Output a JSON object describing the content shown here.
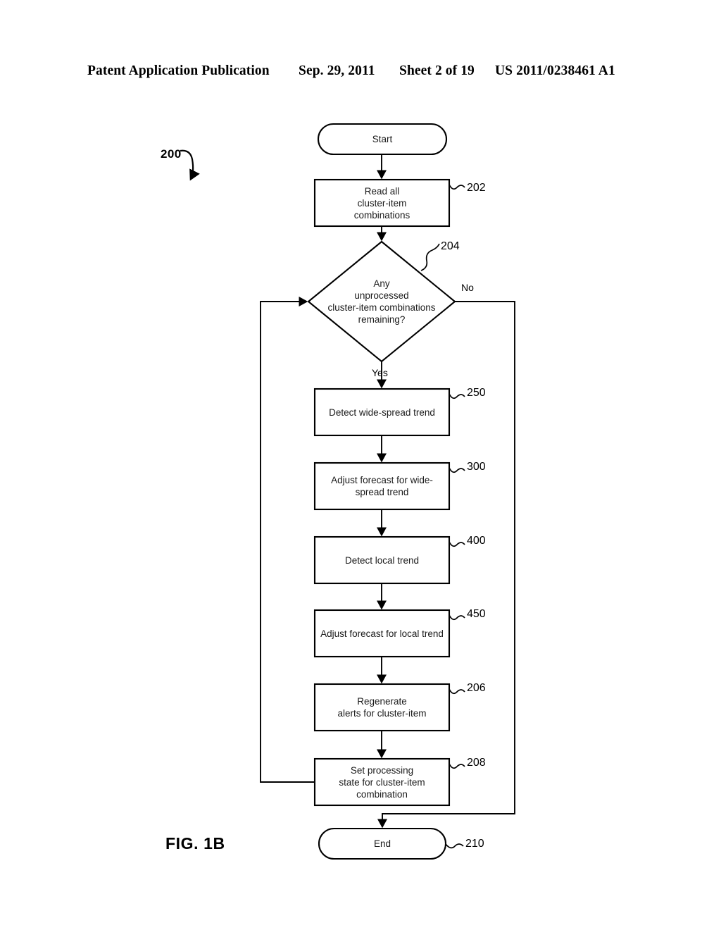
{
  "header": {
    "publication": "Patent Application Publication",
    "date": "Sep. 29, 2011",
    "sheet": "Sheet 2 of 19",
    "number": "US 2011/0238461 A1"
  },
  "figure": {
    "caption": "FIG. 1B",
    "diagram_ref": "200",
    "type": "flowchart"
  },
  "nodes": [
    {
      "id": "start",
      "label": "Start",
      "shape": "terminator",
      "ref": ""
    },
    {
      "id": "n202",
      "label": "Read all\ncluster-item\ncombinations",
      "shape": "process",
      "ref": "202"
    },
    {
      "id": "n204",
      "label": "Any\nunprocessed\ncluster-item combinations\nremaining?",
      "shape": "decision",
      "ref": "204"
    },
    {
      "id": "n250",
      "label": "Detect wide-spread trend",
      "shape": "process",
      "ref": "250"
    },
    {
      "id": "n300",
      "label": "Adjust forecast for wide-\nspread trend",
      "shape": "process",
      "ref": "300"
    },
    {
      "id": "n400",
      "label": "Detect local trend",
      "shape": "process",
      "ref": "400"
    },
    {
      "id": "n450",
      "label": "Adjust forecast for local trend",
      "shape": "process",
      "ref": "450"
    },
    {
      "id": "n206",
      "label": "Regenerate\nalerts for cluster-item",
      "shape": "process",
      "ref": "206"
    },
    {
      "id": "n208",
      "label": "Set processing\nstate for cluster-item\ncombination",
      "shape": "process",
      "ref": "208"
    },
    {
      "id": "end",
      "label": "End",
      "shape": "terminator",
      "ref": "210"
    }
  ],
  "edge_labels": {
    "decision_no": "No",
    "decision_yes": "Yes"
  },
  "colors": {
    "stroke": "#000000",
    "background": "#ffffff",
    "text": "#1a1a1a"
  }
}
